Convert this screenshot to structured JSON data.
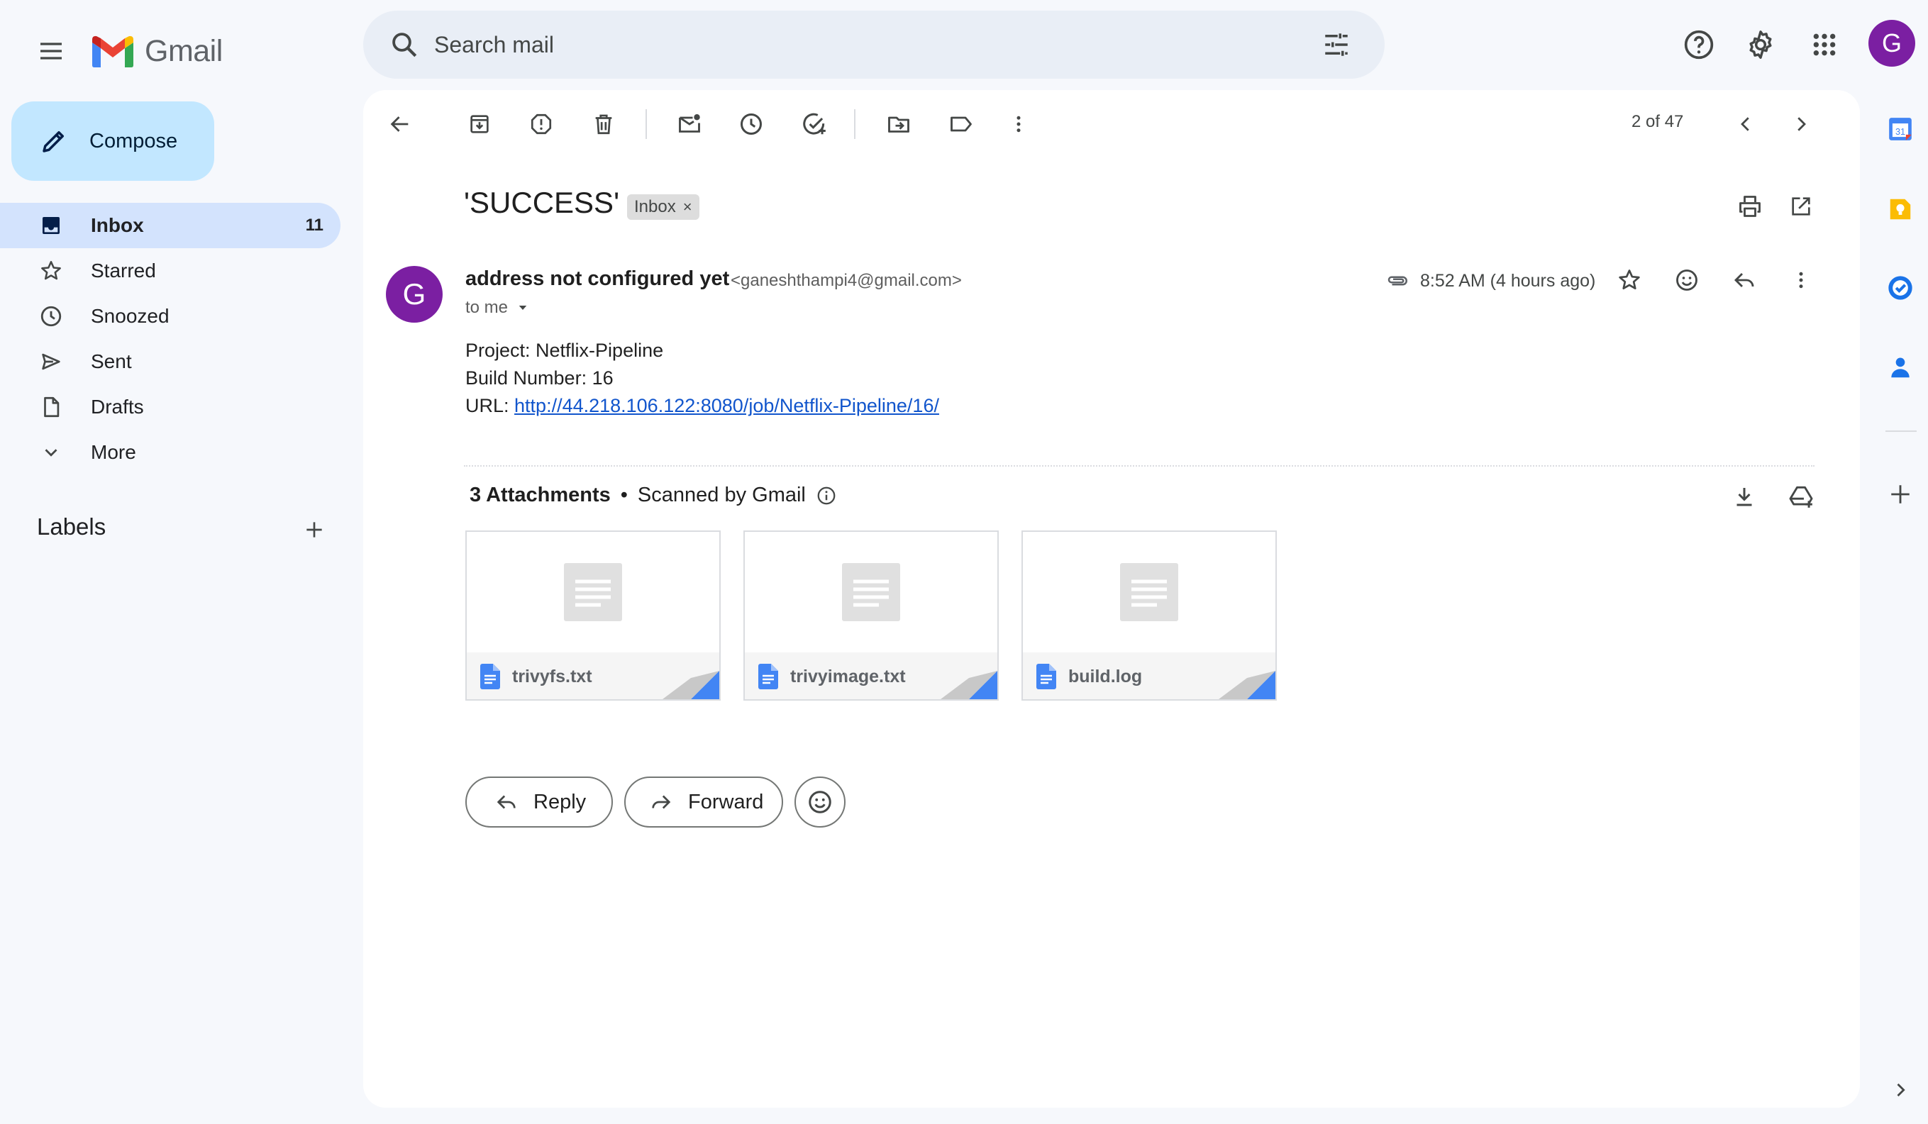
{
  "app": {
    "name": "Gmail"
  },
  "search": {
    "placeholder": "Search mail"
  },
  "sidebar": {
    "compose_label": "Compose",
    "items": [
      {
        "label": "Inbox",
        "count": "11"
      },
      {
        "label": "Starred",
        "count": ""
      },
      {
        "label": "Snoozed",
        "count": ""
      },
      {
        "label": "Sent",
        "count": ""
      },
      {
        "label": "Drafts",
        "count": ""
      },
      {
        "label": "More",
        "count": ""
      }
    ],
    "labels_title": "Labels"
  },
  "toolbar": {
    "pager": "2 of 47"
  },
  "email": {
    "subject": "'SUCCESS'",
    "label_chip": "Inbox",
    "chip_close": "×",
    "sender_initial": "G",
    "sender_name": "address not configured yet",
    "sender_email": "<ganeshthampi4@gmail.com>",
    "to": "to me",
    "time": "8:52 AM (4 hours ago)",
    "body": {
      "line1": "Project: Netflix-Pipeline",
      "line2": "Build Number: 16",
      "url_prefix": "URL: ",
      "url": "http://44.218.106.122:8080/job/Netflix-Pipeline/16/"
    },
    "attachments_header": {
      "count": "3 Attachments",
      "separator": "•",
      "scanned": "Scanned by Gmail"
    },
    "attachments": [
      {
        "name": "trivyfs.txt"
      },
      {
        "name": "trivyimage.txt"
      },
      {
        "name": "build.log"
      }
    ],
    "reply_label": "Reply",
    "forward_label": "Forward"
  },
  "account": {
    "initial": "G"
  },
  "side_apps": {
    "calendar_day": "31"
  },
  "colors": {
    "accent_compose": "#c2e7ff",
    "active_nav": "#d3e3fd",
    "avatar": "#7b1fa2",
    "link": "#1155cc"
  }
}
